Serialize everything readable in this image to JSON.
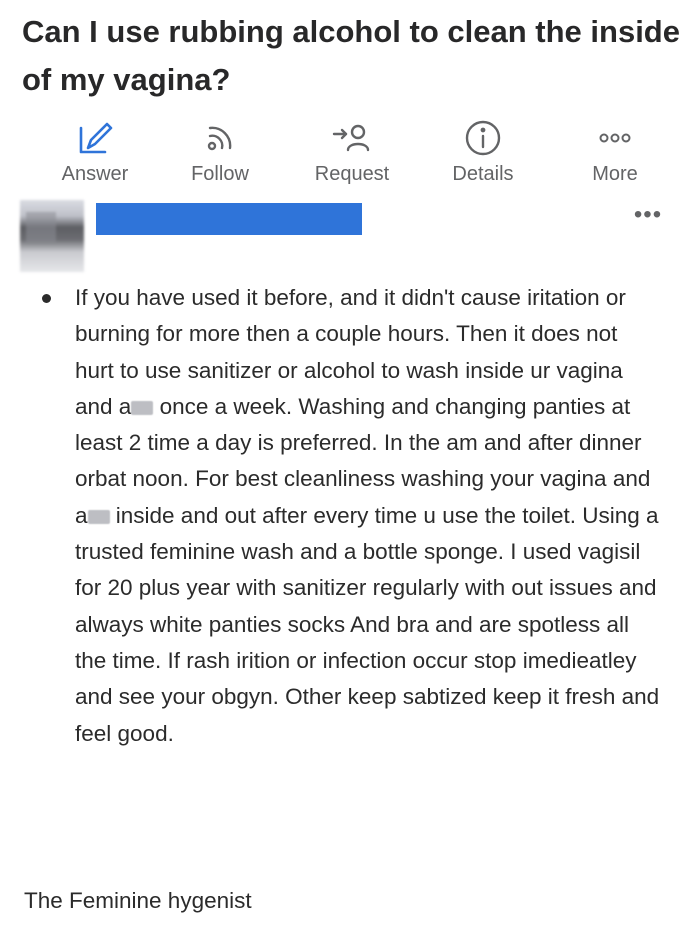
{
  "question": {
    "title": "Can I use rubbing alcohol to clean the inside of my vagina?"
  },
  "actions": [
    {
      "label": "Answer",
      "icon": "pencil-icon"
    },
    {
      "label": "Follow",
      "icon": "rss-follow-icon"
    },
    {
      "label": "Request",
      "icon": "request-person-icon"
    },
    {
      "label": "Details",
      "icon": "info-icon"
    },
    {
      "label": "More",
      "icon": "more-dots-icon"
    }
  ],
  "colors": {
    "accent": "#2f74d9",
    "text": "#2b2b2b",
    "muted": "#636466"
  },
  "answer": {
    "more_icon": "•••",
    "part1": "If you have used it before, and it didn't cause iritation or burning for more then a couple hours. Then it does not hurt to use sanitizer or alcohol to wash inside ur vagina and a",
    "part2": " once a week. Washing and changing panties at least 2 time a day is preferred. In the am and after dinner orbat noon. For best cleanliness washing your vagina and a",
    "part3": " inside and out after every time u use the toilet. Using a trusted feminine wash and a bottle sponge. I used vagisil for 20 plus year with sanitizer regularly with out issues and always white panties socks And bra and are spotless all the time. If rash irition or infection occur stop imedieatley and see your obgyn. Other keep sabtized keep it fresh and feel good.",
    "signature": "The Feminine hygenist"
  }
}
